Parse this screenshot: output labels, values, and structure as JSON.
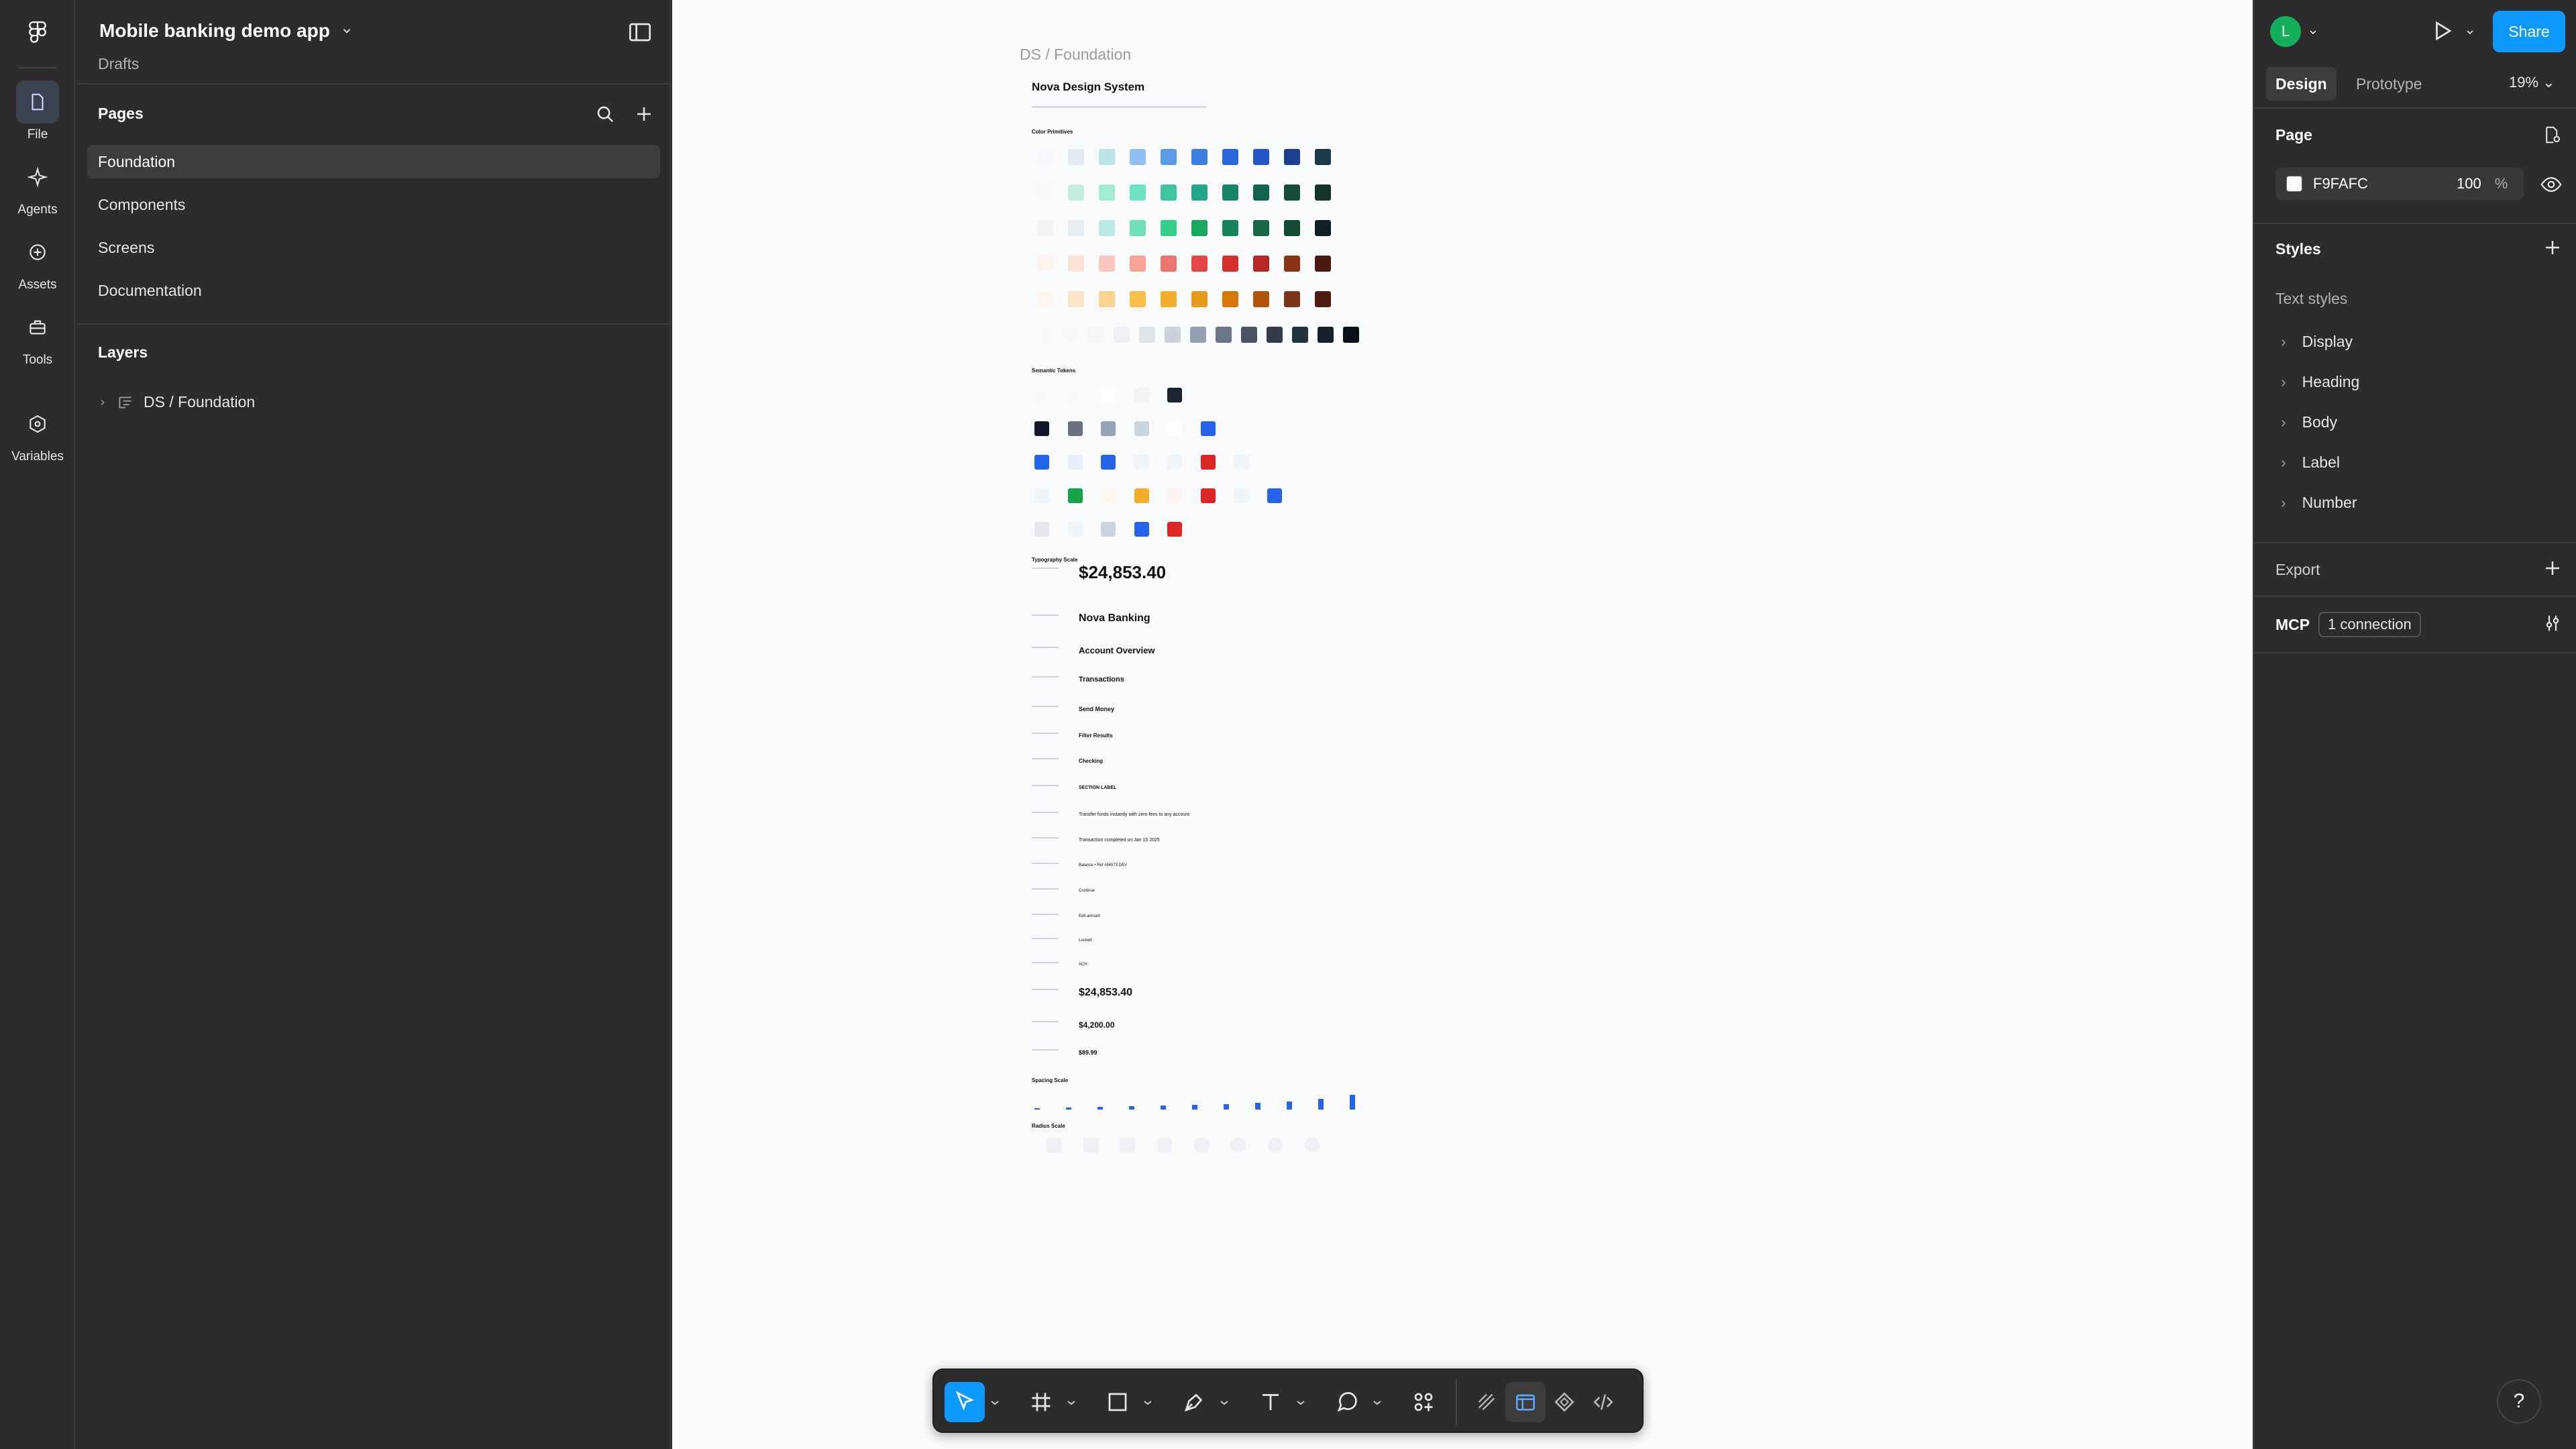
{
  "rail": {
    "items": [
      {
        "label": "File",
        "icon": "file-icon",
        "active": true
      },
      {
        "label": "Agents",
        "icon": "agents-sparkle-icon"
      },
      {
        "label": "Assets",
        "icon": "assets-icon"
      },
      {
        "label": "Tools",
        "icon": "toolbox-icon"
      },
      {
        "label": "Variables",
        "icon": "variables-icon"
      }
    ]
  },
  "left_panel": {
    "file_title": "Mobile banking demo app",
    "project": "Drafts",
    "pages_title": "Pages",
    "pages": [
      "Foundation",
      "Components",
      "Screens",
      "Documentation"
    ],
    "selected_page": "Foundation",
    "layers_title": "Layers",
    "layers": [
      "DS / Foundation"
    ]
  },
  "canvas": {
    "frame_label": "DS / Foundation",
    "doc_title": "Nova Design System",
    "sections": {
      "colors": "Color Primitives",
      "semantic": "Semantic Tokens",
      "typography": "Typography Scale",
      "spacing": "Spacing Scale",
      "radius": "Radius Scale"
    },
    "type_samples": [
      "$24,853.40",
      "Nova Banking",
      "Account Overview",
      "Transactions",
      "Send Money",
      "Filter Results",
      "Checking",
      "SECTION LABEL",
      "Transfer funds instantly with zero fees to any account",
      "Transaction completed on Jan 15 2025",
      "Balance • Ref #84573 DEV",
      "Continue",
      "Edit amount",
      "Locked",
      "ACH",
      "$24,853.40",
      "$4,200.00",
      "$89.99"
    ],
    "palette_colors": {
      "blue": [
        "#f5f7fa",
        "#e4ebf2",
        "#b9e4e8",
        "#8fc2f2",
        "#5b9be8",
        "#3b7de0",
        "#2a67d9",
        "#2356c9",
        "#1d3f8f",
        "#1a3a4a"
      ],
      "mint": [
        "#f7f8f9",
        "#c4eee0",
        "#a1ead3",
        "#6fe3bf",
        "#3ec4a0",
        "#22a687",
        "#188467",
        "#13634f",
        "#154b3b",
        "#12342b"
      ],
      "green": [
        "#f2f3f5",
        "#e9ecef",
        "#b9ebe4",
        "#6fe0b9",
        "#36cf8c",
        "#1aa860",
        "#15845a",
        "#176645",
        "#124c35",
        "#102126"
      ],
      "red": [
        "#fdf3ee",
        "#fde2d6",
        "#f9c7bd",
        "#f5a596",
        "#ee7470",
        "#e44545",
        "#d62e2e",
        "#b82626",
        "#8a3216",
        "#4a1912"
      ],
      "amber": [
        "#fdf6ec",
        "#fde6c8",
        "#fbd28e",
        "#f9bf49",
        "#f4ad2a",
        "#e69b1d",
        "#d97706",
        "#b45309",
        "#7c3519",
        "#4d1c0f"
      ],
      "gray": [
        "#f8f9fb",
        "#f8f9fb",
        "#f5f6f8",
        "#eef0f3",
        "#e0e3e8",
        "#cbd2dc",
        "#95a1b2",
        "#6b7688",
        "#4a5364",
        "#333b48",
        "#1f3240",
        "#15202b",
        "#0b1118"
      ]
    },
    "accent_blue": "#2563eb"
  },
  "right_panel": {
    "avatar_initial": "L",
    "share_label": "Share",
    "tabs": [
      "Design",
      "Prototype"
    ],
    "zoom": "19%",
    "page_title": "Page",
    "page_color": "F9FAFC",
    "page_opacity": "100",
    "percent": "%",
    "styles_title": "Styles",
    "text_styles_title": "Text styles",
    "text_styles": [
      "Display",
      "Heading",
      "Body",
      "Label",
      "Number"
    ],
    "export_title": "Export",
    "mcp_title": "MCP",
    "mcp_badge": "1 connection"
  },
  "help_label": "?"
}
